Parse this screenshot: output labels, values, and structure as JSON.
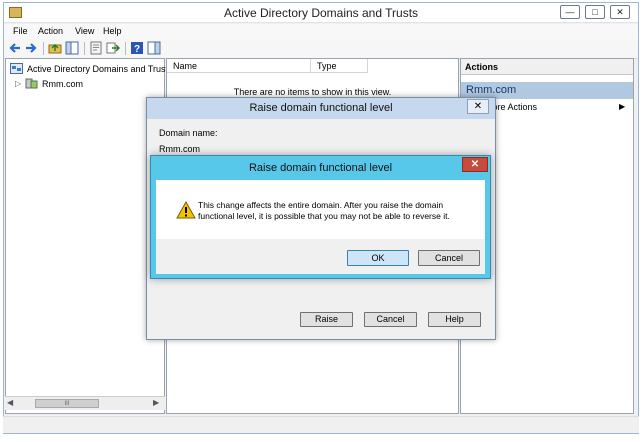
{
  "window": {
    "title": "Active Directory Domains and Trusts",
    "minimize": "—",
    "maximize": "□",
    "close": "✕"
  },
  "menu": [
    "File",
    "Action",
    "View",
    "Help"
  ],
  "tree": {
    "root": "Active Directory Domains and Trust",
    "child": "Rmm.com"
  },
  "list": {
    "columns": [
      "Name",
      "Type"
    ],
    "empty": "There are no items to show in this view."
  },
  "actions": {
    "header": "Actions",
    "domain": "Rmm.com",
    "more": "More Actions"
  },
  "dialog1": {
    "title": "Raise domain functional level",
    "domain_label": "Domain name:",
    "domain_value": "Rmm.com",
    "raise": "Raise",
    "cancel": "Cancel",
    "help": "Help",
    "close": "✕"
  },
  "dialog2": {
    "title": "Raise domain functional level",
    "close": "✕",
    "message": "This change affects the entire domain. After you raise the domain functional level, it is possible that you may not be able to reverse it.",
    "ok": "OK",
    "cancel": "Cancel"
  },
  "scrollbar": {
    "thumb": "III"
  },
  "colors": {
    "dialog_border": "#58c8ea",
    "close_red": "#c74b3c",
    "selection": "#b0c8e0"
  }
}
